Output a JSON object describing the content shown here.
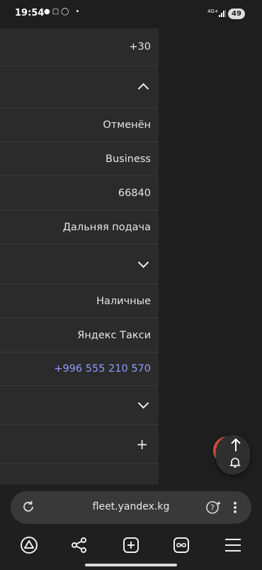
{
  "status_bar": {
    "time": "19:54",
    "network": "4G+",
    "battery": "49"
  },
  "rows": [
    {
      "type": "text",
      "value": "+30"
    },
    {
      "type": "chevron-up"
    },
    {
      "type": "text",
      "value": "Отменён"
    },
    {
      "type": "text",
      "value": "Business"
    },
    {
      "type": "text",
      "value": "66840"
    },
    {
      "type": "text",
      "value": "Дальняя подача"
    },
    {
      "type": "chevron-down"
    },
    {
      "type": "text",
      "value": "Наличные"
    },
    {
      "type": "text",
      "value": "Яндекс Такси"
    },
    {
      "type": "link",
      "value": "+996 555 210 570"
    },
    {
      "type": "chevron-down"
    },
    {
      "type": "plus"
    }
  ],
  "browser": {
    "url": "fleet.yandex.kg"
  },
  "colors": {
    "link": "#8f9cff",
    "accent": "#e2533d",
    "panel": "#2b2b2b"
  }
}
